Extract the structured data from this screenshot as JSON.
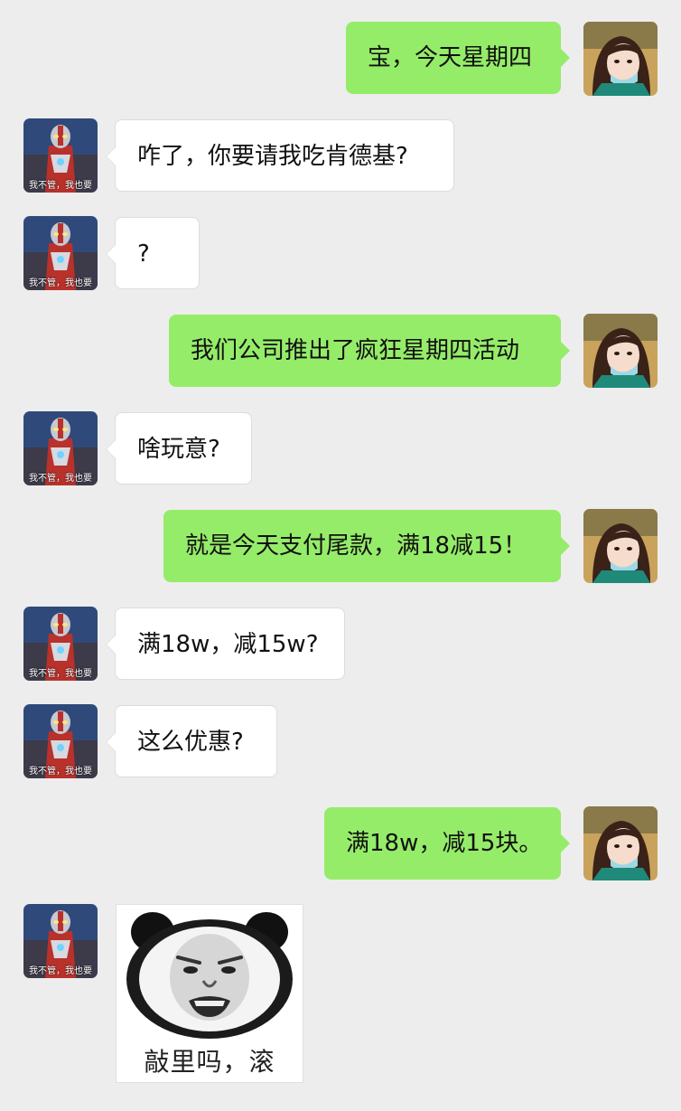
{
  "chat": {
    "messages": [
      {
        "side": "out",
        "text": "宝，今天星期四"
      },
      {
        "side": "in",
        "text": "咋了，你要请我吃肯德基?"
      },
      {
        "side": "in",
        "text": "?"
      },
      {
        "side": "out",
        "text": "我们公司推出了疯狂星期四活动"
      },
      {
        "side": "in",
        "text": "啥玩意?"
      },
      {
        "side": "out",
        "text": "就是今天支付尾款，满18减15！"
      },
      {
        "side": "in",
        "text": "满18w，减15w?"
      },
      {
        "side": "in",
        "text": "这么优惠?"
      },
      {
        "side": "out",
        "text": "满18w，减15块。"
      },
      {
        "side": "in",
        "type": "sticker",
        "text": "敲里吗，滚"
      }
    ],
    "contact_avatar": {
      "caption": "我不管，我也要",
      "icon": "red-hero-avatar"
    },
    "self_avatar": {
      "icon": "girl-selfie-avatar"
    },
    "colors": {
      "background": "#ededed",
      "outgoing_bubble": "#95ec69",
      "incoming_bubble": "#ffffff"
    }
  }
}
